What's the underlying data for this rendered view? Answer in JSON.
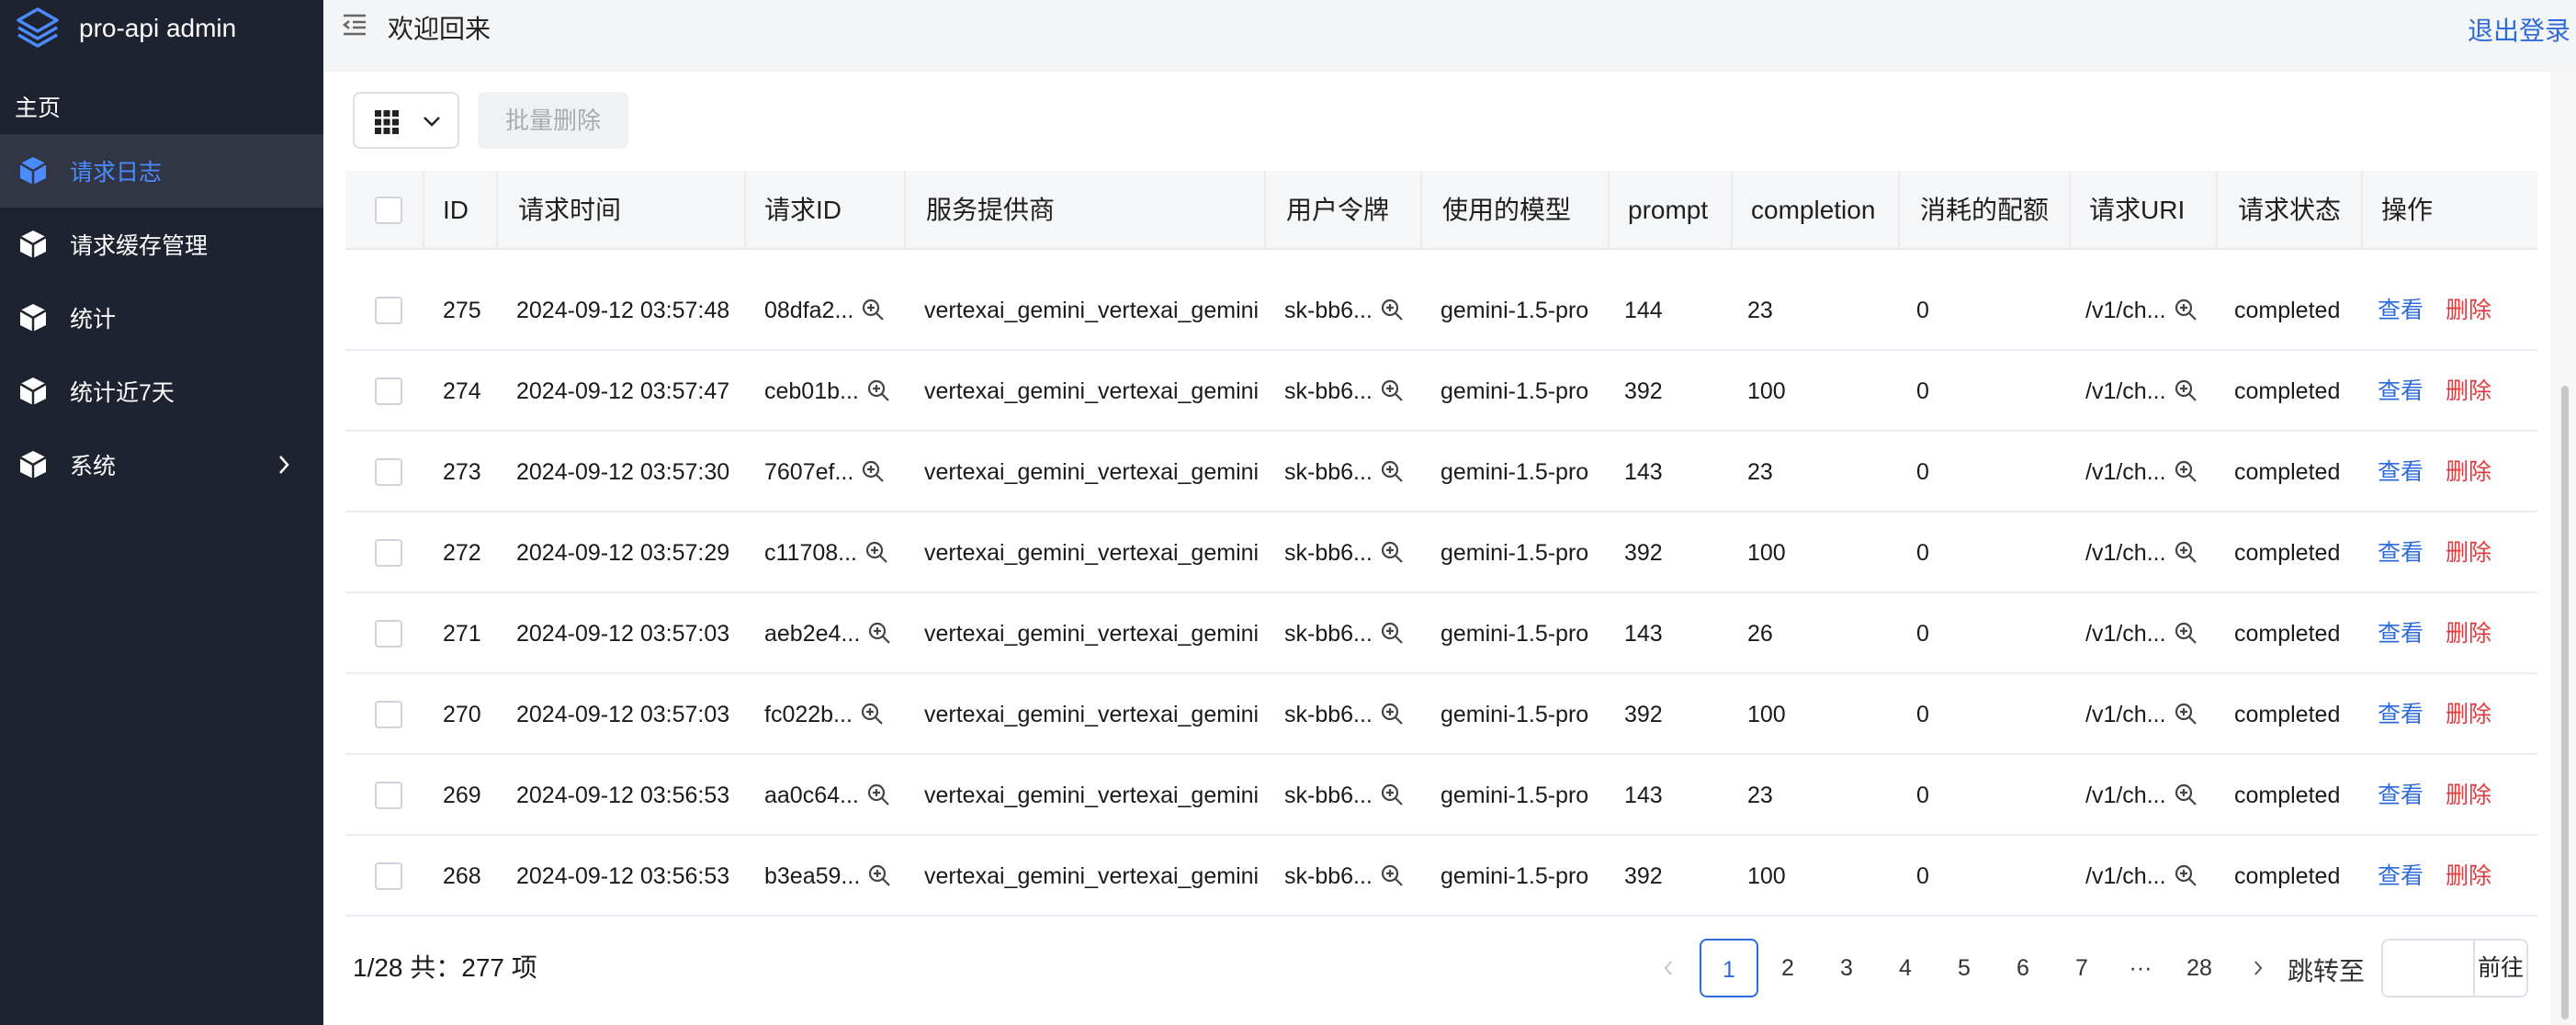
{
  "app": {
    "name": "pro-api admin"
  },
  "sidebar": {
    "home": "主页",
    "items": [
      {
        "label": "请求日志"
      },
      {
        "label": "请求缓存管理"
      },
      {
        "label": "统计"
      },
      {
        "label": "统计近7天"
      },
      {
        "label": "系统"
      }
    ]
  },
  "header": {
    "welcome": "欢迎回来",
    "logout": "退出登录"
  },
  "toolbar": {
    "batch_delete": "批量删除"
  },
  "table": {
    "columns": [
      "ID",
      "请求时间",
      "请求ID",
      "服务提供商",
      "用户令牌",
      "使用的模型",
      "prompt",
      "completion",
      "消耗的配额",
      "请求URI",
      "请求状态",
      "操作"
    ],
    "rows": [
      {
        "id": "275",
        "time": "2024-09-12 03:57:48",
        "req_id": "08dfa2...",
        "provider": "vertexai_gemini_vertexai_gemini",
        "token": "sk-bb6...",
        "model": "gemini-1.5-pro",
        "prompt": "144",
        "completion": "23",
        "quota": "0",
        "uri": "/v1/ch...",
        "status": "completed",
        "view": "查看",
        "del": "删除"
      },
      {
        "id": "274",
        "time": "2024-09-12 03:57:47",
        "req_id": "ceb01b...",
        "provider": "vertexai_gemini_vertexai_gemini",
        "token": "sk-bb6...",
        "model": "gemini-1.5-pro",
        "prompt": "392",
        "completion": "100",
        "quota": "0",
        "uri": "/v1/ch...",
        "status": "completed",
        "view": "查看",
        "del": "删除"
      },
      {
        "id": "273",
        "time": "2024-09-12 03:57:30",
        "req_id": "7607ef...",
        "provider": "vertexai_gemini_vertexai_gemini",
        "token": "sk-bb6...",
        "model": "gemini-1.5-pro",
        "prompt": "143",
        "completion": "23",
        "quota": "0",
        "uri": "/v1/ch...",
        "status": "completed",
        "view": "查看",
        "del": "删除"
      },
      {
        "id": "272",
        "time": "2024-09-12 03:57:29",
        "req_id": "c11708...",
        "provider": "vertexai_gemini_vertexai_gemini",
        "token": "sk-bb6...",
        "model": "gemini-1.5-pro",
        "prompt": "392",
        "completion": "100",
        "quota": "0",
        "uri": "/v1/ch...",
        "status": "completed",
        "view": "查看",
        "del": "删除"
      },
      {
        "id": "271",
        "time": "2024-09-12 03:57:03",
        "req_id": "aeb2e4...",
        "provider": "vertexai_gemini_vertexai_gemini",
        "token": "sk-bb6...",
        "model": "gemini-1.5-pro",
        "prompt": "143",
        "completion": "26",
        "quota": "0",
        "uri": "/v1/ch...",
        "status": "completed",
        "view": "查看",
        "del": "删除"
      },
      {
        "id": "270",
        "time": "2024-09-12 03:57:03",
        "req_id": "fc022b...",
        "provider": "vertexai_gemini_vertexai_gemini",
        "token": "sk-bb6...",
        "model": "gemini-1.5-pro",
        "prompt": "392",
        "completion": "100",
        "quota": "0",
        "uri": "/v1/ch...",
        "status": "completed",
        "view": "查看",
        "del": "删除"
      },
      {
        "id": "269",
        "time": "2024-09-12 03:56:53",
        "req_id": "aa0c64...",
        "provider": "vertexai_gemini_vertexai_gemini",
        "token": "sk-bb6...",
        "model": "gemini-1.5-pro",
        "prompt": "143",
        "completion": "23",
        "quota": "0",
        "uri": "/v1/ch...",
        "status": "completed",
        "view": "查看",
        "del": "删除"
      },
      {
        "id": "268",
        "time": "2024-09-12 03:56:53",
        "req_id": "b3ea59...",
        "provider": "vertexai_gemini_vertexai_gemini",
        "token": "sk-bb6...",
        "model": "gemini-1.5-pro",
        "prompt": "392",
        "completion": "100",
        "quota": "0",
        "uri": "/v1/ch...",
        "status": "completed",
        "view": "查看",
        "del": "删除"
      }
    ]
  },
  "footer": {
    "summary": "1/28 共：277 项",
    "pages": [
      "1",
      "2",
      "3",
      "4",
      "5",
      "6",
      "7",
      "···",
      "28"
    ],
    "current_page": "1",
    "jump_label": "跳转至",
    "jump_value": "",
    "go": "前往"
  },
  "colors": {
    "sidebar_bg": "#1f2330",
    "accent": "#2e6bd8",
    "danger": "#e0393e"
  }
}
